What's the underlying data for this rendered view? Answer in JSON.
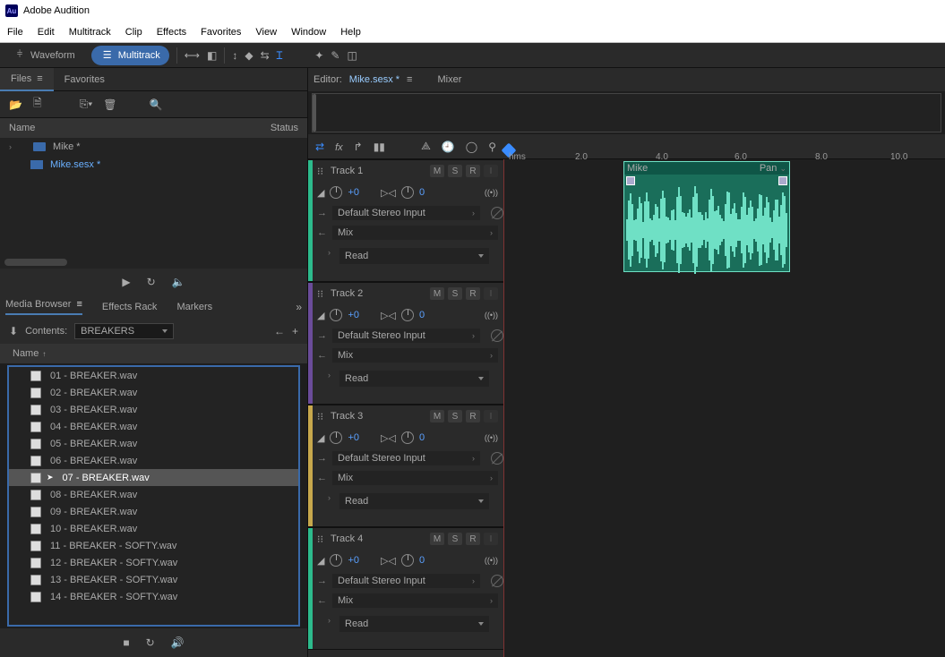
{
  "titlebar": {
    "app": "Au",
    "title": "Adobe Audition"
  },
  "menu": [
    "File",
    "Edit",
    "Multitrack",
    "Clip",
    "Effects",
    "Favorites",
    "View",
    "Window",
    "Help"
  ],
  "modes": {
    "waveform": "Waveform",
    "multitrack": "Multitrack"
  },
  "left_tabs": {
    "files": "Files",
    "favorites": "Favorites"
  },
  "name_header": {
    "name": "Name",
    "status": "Status"
  },
  "project_files": {
    "parent": "Mike *",
    "child": "Mike.sesx *"
  },
  "media_browser": {
    "tabs": [
      "Media Browser",
      "Effects Rack",
      "Markers"
    ],
    "contents_label": "Contents:",
    "contents_value": "BREAKERS",
    "name_header": "Name",
    "items": [
      "01 - BREAKER.wav",
      "02 - BREAKER.wav",
      "03 - BREAKER.wav",
      "04 - BREAKER.wav",
      "05 - BREAKER.wav",
      "06 - BREAKER.wav",
      "07 - BREAKER.wav",
      "08 - BREAKER.wav",
      "09 - BREAKER.wav",
      "10 - BREAKER.wav",
      "11 - BREAKER - SOFTY.wav",
      "12 - BREAKER - SOFTY.wav",
      "13 - BREAKER - SOFTY.wav",
      "14 - BREAKER - SOFTY.wav"
    ],
    "selected_index": 6
  },
  "editor": {
    "label": "Editor:",
    "file": "Mike.sesx *",
    "mixer": "Mixer"
  },
  "timeline": {
    "unit": "hms",
    "marks": [
      "2.0",
      "4.0",
      "6.0",
      "8.0",
      "10.0"
    ]
  },
  "tracks": [
    {
      "name": "Track 1",
      "color": "#2dbb8c",
      "vol": "+0",
      "pan": "0",
      "input": "Default Stereo Input",
      "output": "Mix",
      "automation": "Read"
    },
    {
      "name": "Track 2",
      "color": "#6b4c9a",
      "vol": "+0",
      "pan": "0",
      "input": "Default Stereo Input",
      "output": "Mix",
      "automation": "Read"
    },
    {
      "name": "Track 3",
      "color": "#c7a84c",
      "vol": "+0",
      "pan": "0",
      "input": "Default Stereo Input",
      "output": "Mix",
      "automation": "Read"
    },
    {
      "name": "Track 4",
      "color": "#2dbb8c",
      "vol": "+0",
      "pan": "0",
      "input": "Default Stereo Input",
      "output": "Mix",
      "automation": "Read"
    }
  ],
  "msr": {
    "m": "M",
    "s": "S",
    "r": "R",
    "i": "I"
  },
  "clip": {
    "name": "Mike",
    "pan": "Pan"
  }
}
